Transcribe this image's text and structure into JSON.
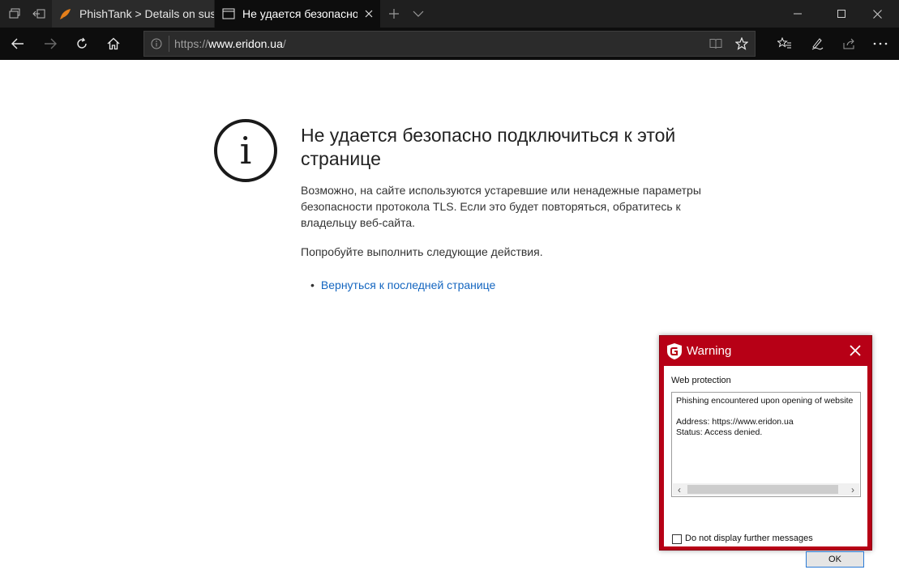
{
  "browser": {
    "tabs": [
      {
        "title": "PhishTank > Details on susp",
        "icon": "phishtank-fish-icon",
        "active": false
      },
      {
        "title": "Не удается безопасно г",
        "icon": "page-icon",
        "active": true
      }
    ],
    "address": {
      "scheme": "https://",
      "host": "www.eridon.ua",
      "path": "/"
    }
  },
  "error_page": {
    "title": "Не удается безопасно подключиться к этой странице",
    "description": "Возможно, на сайте используются устаревшие или ненадежные параметры безопасности протокола TLS. Если это будет повторяться, обратитесь к владельцу веб-сайта.",
    "try_text": "Попробуйте выполнить следующие действия.",
    "actions": [
      {
        "label": "Вернуться к последней странице"
      }
    ]
  },
  "dialog": {
    "title": "Warning",
    "section": "Web protection",
    "message_lines": [
      "Phishing encountered upon opening of website",
      "",
      "Address: https://www.eridon.ua",
      "Status:  Access denied."
    ],
    "checkbox_label": "Do not display further messages",
    "ok_label": "OK"
  },
  "colors": {
    "chrome_dark": "#1f1f1f",
    "dialog_red": "#b70016",
    "link_blue": "#1466c0"
  }
}
